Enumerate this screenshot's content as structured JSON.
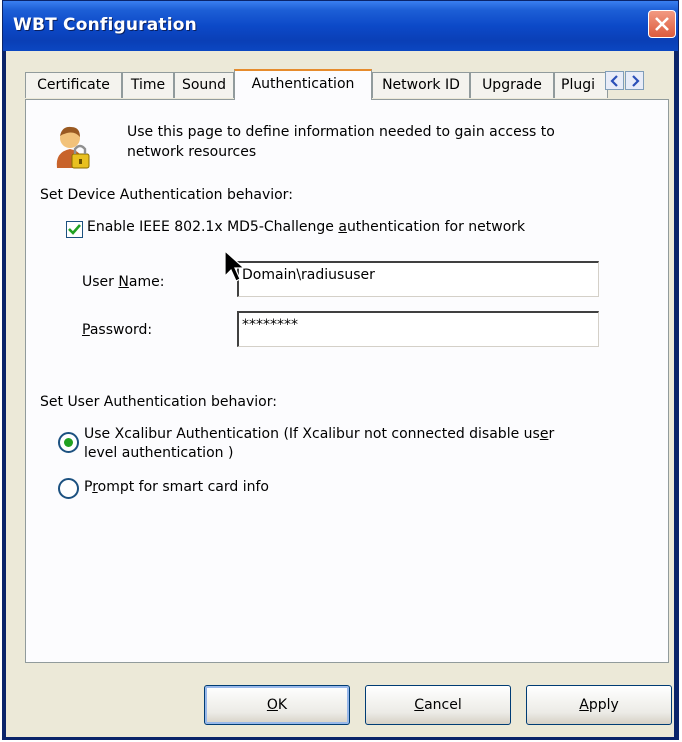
{
  "window": {
    "title": "WBT Configuration"
  },
  "tabs": [
    {
      "label": "Certificate"
    },
    {
      "label": "Time"
    },
    {
      "label": "Sound"
    },
    {
      "label": "Authentication"
    },
    {
      "label": "Network ID"
    },
    {
      "label": "Upgrade"
    },
    {
      "label": "Plugi"
    }
  ],
  "header": {
    "text_line1": "Use this page to define information needed to gain access to",
    "text_line2": "network resources"
  },
  "device_auth": {
    "section_label": "Set Device Authentication behavior:",
    "enable_checkbox": {
      "label_pre": "Enable IEEE 802.1x MD5-Challenge ",
      "label_acc": "a",
      "label_post": "uthentication for network",
      "checked": true
    },
    "username": {
      "label_pre": "User ",
      "label_acc": "N",
      "label_post": "ame:",
      "value": "Domain\\radiususer"
    },
    "password": {
      "label_acc": "P",
      "label_post": "assword:",
      "value": "********"
    }
  },
  "user_auth": {
    "section_label": "Set User Authentication behavior:",
    "option1": {
      "line1_pre": "Use Xcalibur Authentication (If Xcalibur not connected disable us",
      "line1_acc": "e",
      "line1_post": "r",
      "line2": "level authentication )",
      "selected": true
    },
    "option2": {
      "label_pre": "P",
      "label_acc": "r",
      "label_post": "ompt for smart card  info",
      "selected": false
    }
  },
  "buttons": {
    "ok": {
      "label_acc": "O",
      "label_post": "K"
    },
    "cancel": {
      "label_acc": "C",
      "label_post": "ancel"
    },
    "apply": {
      "label_acc": "A",
      "label_post": "pply"
    }
  },
  "colors": {
    "titlebar": "#0c49c8",
    "tab_highlight": "#e68b2c",
    "check_green": "#21a121",
    "dialog_bg": "#ece9d8"
  }
}
